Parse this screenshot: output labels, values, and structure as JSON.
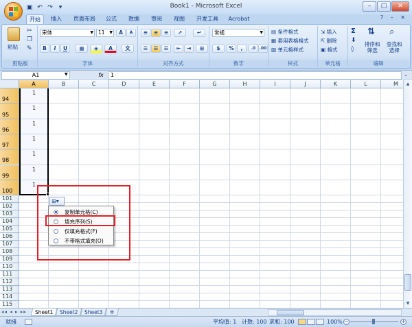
{
  "window": {
    "title": "Book1 - Microsoft Excel",
    "controls": [
      "–",
      "□",
      "✕"
    ],
    "qat_icons": [
      "save-icon",
      "undo-icon",
      "redo-icon",
      "customize-icon"
    ]
  },
  "ribbon": {
    "tabs": [
      "开始",
      "插入",
      "页面布局",
      "公式",
      "数据",
      "审阅",
      "视图",
      "开发工具",
      "Acrobat"
    ],
    "active_tab": "开始",
    "help": "?  –  ✕",
    "groups": {
      "clipboard": {
        "label": "剪贴板",
        "paste": "粘贴"
      },
      "font": {
        "label": "字体",
        "font_name": "宋体",
        "font_size": "11",
        "grow": "A",
        "shrink": "A",
        "bold": "B",
        "italic": "I",
        "underline": "U",
        "wen": "文"
      },
      "alignment": {
        "label": "对齐方式"
      },
      "number": {
        "label": "数字",
        "format": "常规",
        "percent": "%",
        "comma": ","
      },
      "styles": {
        "label": "样式",
        "items": [
          "条件格式",
          "套用表格格式",
          "单元格样式"
        ]
      },
      "cells": {
        "label": "单元格",
        "items": [
          "插入",
          "删除",
          "格式"
        ]
      },
      "editing": {
        "label": "编辑",
        "sigma": "Σ",
        "sort": "排序和\n筛选",
        "find": "查找和\n选择"
      }
    }
  },
  "formula_bar": {
    "name_box": "A1",
    "fx": "fx",
    "value": "1"
  },
  "grid": {
    "columns": [
      "A",
      "B",
      "C",
      "D",
      "E",
      "F",
      "G",
      "H",
      "I",
      "J",
      "K",
      "L",
      "M"
    ],
    "selected_column": "A",
    "rows": [
      "94",
      "95",
      "96",
      "97",
      "98",
      "99",
      "100",
      "101",
      "102",
      "103",
      "104",
      "105",
      "106",
      "107",
      "108",
      "109",
      "110",
      "111",
      "112",
      "113",
      "114",
      "115"
    ],
    "selected_rows": [
      "94",
      "95",
      "96",
      "97",
      "98",
      "99",
      "100"
    ],
    "cell_values": [
      "1",
      "1",
      "1",
      "1",
      "1",
      "1",
      "1"
    ]
  },
  "autofill": {
    "button_icon": "autofill-options-icon",
    "options": [
      {
        "label": "复制单元格(C)",
        "checked": true
      },
      {
        "label": "填充序列(S)",
        "checked": false
      },
      {
        "label": "仅填充格式(F)",
        "checked": false
      },
      {
        "label": "不带格式填充(O)",
        "checked": false
      }
    ],
    "highlight_color": "#e31e24"
  },
  "sheets": {
    "nav": "◂◂ ◂ ▸ ▸▸",
    "tabs": [
      "Sheet1",
      "Sheet2",
      "Sheet3"
    ],
    "active": "Sheet1"
  },
  "status": {
    "ready": "就绪",
    "average": "平均值: 1",
    "count": "计数: 100",
    "sum": "求和: 100",
    "zoom": "100%"
  }
}
